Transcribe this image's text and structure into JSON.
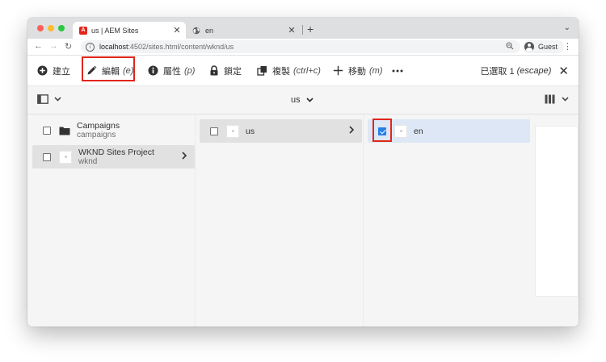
{
  "browser": {
    "tabs": [
      {
        "title": "us | AEM Sites",
        "favicon": "adobe-icon",
        "active": true
      },
      {
        "title": "en",
        "favicon": "globe-icon",
        "active": false
      }
    ],
    "new_tab_label": "+",
    "url_host": "localhost",
    "url_path": ":4502/sites.html/content/wknd/us",
    "profile_name": "Guest"
  },
  "actionbar": {
    "create": {
      "label": "建立",
      "icon": "plus-circle-icon"
    },
    "edit": {
      "label": "編輯",
      "shortcut": "(e)",
      "icon": "pencil-icon"
    },
    "properties": {
      "label": "屬性",
      "shortcut": "(p)",
      "icon": "info-icon"
    },
    "lock": {
      "label": "鎖定",
      "icon": "lock-icon"
    },
    "copy": {
      "label": "複製",
      "shortcut": "(ctrl+c)",
      "icon": "copy-icon"
    },
    "move": {
      "label": "移動",
      "shortcut": "(m)",
      "icon": "move-icon"
    },
    "more_icon": "ellipsis-icon",
    "selection_label": "已選取 1",
    "selection_shortcut": "(escape)"
  },
  "subbar": {
    "breadcrumb": "us"
  },
  "columns": [
    {
      "items": [
        {
          "title": "Campaigns",
          "subtitle": "campaigns",
          "icon": "folder-icon",
          "checked": false,
          "has_children": false,
          "active": false
        },
        {
          "title": "WKND Sites Project",
          "subtitle": "wknd",
          "icon": "page-thumbnail",
          "checked": false,
          "has_children": true,
          "active": true
        }
      ]
    },
    {
      "items": [
        {
          "title": "us",
          "subtitle": "",
          "icon": "page-thumbnail",
          "checked": false,
          "has_children": true,
          "active": true
        }
      ]
    },
    {
      "items": [
        {
          "title": "en",
          "subtitle": "",
          "icon": "page-thumbnail",
          "checked": true,
          "has_children": false,
          "active": true
        }
      ]
    }
  ],
  "colors": {
    "highlight": "#e0261b",
    "selected_row": "#dde7f5",
    "active_row": "#e1e1e1",
    "checkbox_blue": "#2680eb"
  }
}
